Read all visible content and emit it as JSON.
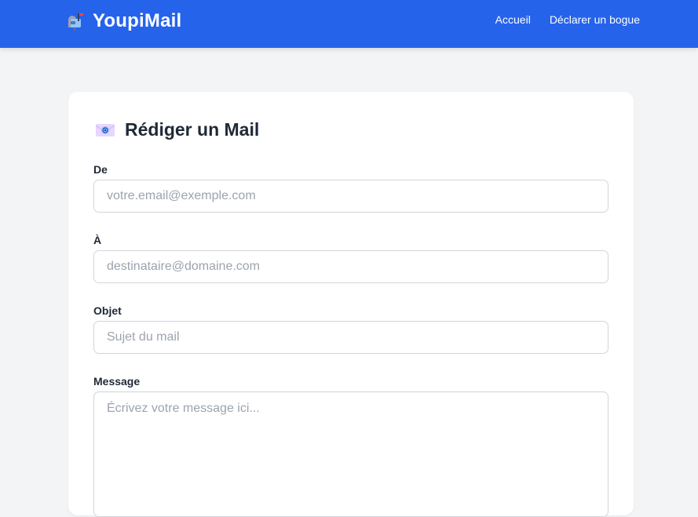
{
  "app": {
    "brand_name": "YoupiMail",
    "brand_icon": "mailbox-icon",
    "accent_color": "#2563eb"
  },
  "nav": {
    "items": [
      {
        "label": "Accueil"
      },
      {
        "label": "Déclarer un bogue"
      }
    ]
  },
  "compose": {
    "title": "Rédiger un Mail",
    "title_icon": "envelope-icon",
    "fields": {
      "from": {
        "label": "De",
        "placeholder": "votre.email@exemple.com",
        "value": ""
      },
      "to": {
        "label": "À",
        "placeholder": "destinataire@domaine.com",
        "value": ""
      },
      "subject": {
        "label": "Objet",
        "placeholder": "Sujet du mail",
        "value": ""
      },
      "message": {
        "label": "Message",
        "placeholder": "Écrivez votre message ici...",
        "value": ""
      }
    }
  }
}
